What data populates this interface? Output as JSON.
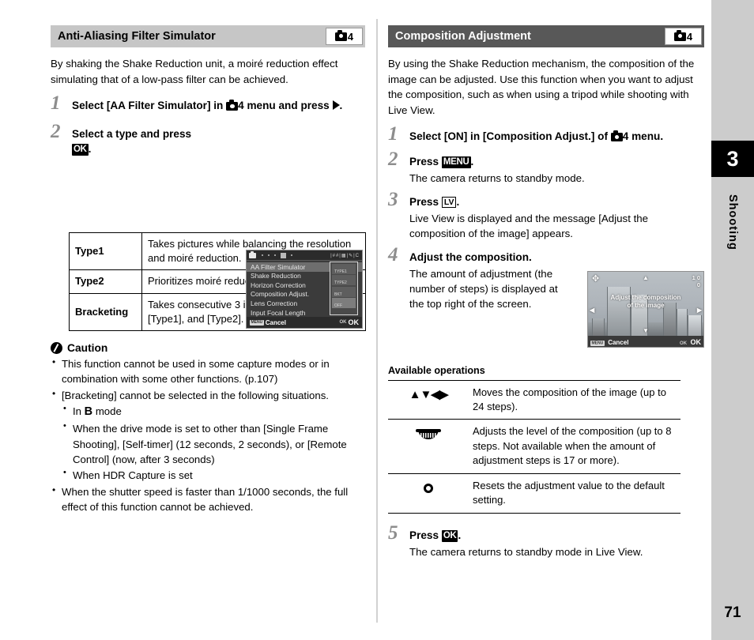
{
  "rail": {
    "chapter_number": "3",
    "chapter_label": "Shooting",
    "page_number": "71"
  },
  "left_column": {
    "header": {
      "title": "Anti-Aliasing Filter Simulator",
      "badge_icon": "camera-icon",
      "badge_number": "4"
    },
    "intro": "By shaking the Shake Reduction unit, a moiré reduction effect simulating that of a low-pass filter can be achieved.",
    "steps": [
      {
        "number": "1",
        "title_pre": "Select [AA Filter Simulator] in ",
        "title_badge_number": "4",
        "title_post": " menu and press "
      },
      {
        "number": "2",
        "title_pre": "Select a type and press ",
        "key": "OK",
        "title_post": "."
      }
    ],
    "menu_screenshot": {
      "name": "aa-filter-simulator-menu",
      "items": [
        "AA Filter Simulator",
        "Shake Reduction",
        "Horizon Correction",
        "Composition Adjust.",
        "Lens Correction",
        "Input Focal Length"
      ],
      "selected_item": "AA Filter Simulator",
      "options": [
        "TYPE1",
        "TYPE2",
        "BKT",
        "OFF"
      ],
      "selected_option": "OFF",
      "bottom_left_key": "MENU",
      "bottom_left_label": "Cancel",
      "bottom_right_key": "OK",
      "bottom_right_label": "OK",
      "top_right_tabs": "|##|▦|✎|C"
    },
    "type_table": {
      "rows": [
        {
          "key": "Type1",
          "value": "Takes pictures while balancing the resolution and moiré reduction."
        },
        {
          "key": "Type2",
          "value": "Prioritizes moiré reduction."
        },
        {
          "key": "Bracketing",
          "value": "Takes consecutive 3 images in order of [Off], [Type1], and [Type2]."
        }
      ]
    },
    "caution": {
      "title": "Caution",
      "icon": "caution-icon",
      "bullets": [
        {
          "text": "This function cannot be used in some capture modes or in combination with some other functions. (p.107)"
        },
        {
          "text": "[Bracketing] cannot be selected in the following situations.",
          "sub": [
            {
              "pre": "In ",
              "key": "B",
              "post": " mode"
            },
            {
              "pre": "When the drive mode is set to other than [Single Frame Shooting], [Self-timer] (12 seconds, 2 seconds), or [Remote Control] (now, after 3 seconds)"
            },
            {
              "pre": "When HDR Capture is set"
            }
          ]
        },
        {
          "text": "When the shutter speed is faster than 1/1000 seconds, the full effect of this function cannot be achieved."
        }
      ]
    }
  },
  "right_column": {
    "header": {
      "title": "Composition Adjustment",
      "badge_icon": "camera-icon",
      "badge_number": "4"
    },
    "intro": "By using the Shake Reduction mechanism, the composition of the image can be adjusted. Use this function when you want to adjust the composition, such as when using a tripod while shooting with Live View.",
    "steps": [
      {
        "number": "1",
        "title_pre": "Select [ON] in [Composition Adjust.] of ",
        "title_badge_number": "4",
        "title_post": " menu.",
        "desc": ""
      },
      {
        "number": "2",
        "title_pre": "Press ",
        "key": "MENU",
        "title_post": ".",
        "desc": "The camera returns to standby mode."
      },
      {
        "number": "3",
        "title_pre": "Press ",
        "key": "LV",
        "title_post": ".",
        "desc": "Live View is displayed and the message [Adjust the composition of the image] appears."
      },
      {
        "number": "4",
        "title_pre": "Adjust the composition.",
        "desc": "The amount of adjustment (the number of steps) is displayed at the top right of the screen."
      },
      {
        "number": "5",
        "title_pre": "Press ",
        "key": "OK",
        "title_post": ".",
        "desc": "The camera returns to standby mode in Live View."
      }
    ],
    "lv_screenshot": {
      "name": "live-view-composition-adjust",
      "message_line1": "Adjust the composition",
      "message_line2": "of the image",
      "steps_readout": "1 0",
      "readout_h": "0",
      "readout_v": "0",
      "bottom_left_key": "MENU",
      "bottom_left_label": "Cancel",
      "bottom_right_key": "OK",
      "bottom_right_label": "OK"
    },
    "operations": {
      "title": "Available operations",
      "rows": [
        {
          "icon": "arrow-pad-icon",
          "icon_text": "▲▼◀▶",
          "desc": "Moves the composition of the image (up to 24 steps)."
        },
        {
          "icon": "e-dial-icon",
          "icon_text": "",
          "desc": "Adjusts the level of the composition (up to 8 steps. Not available when the amount of adjustment steps is 17 or more)."
        },
        {
          "icon": "green-button-icon",
          "icon_text": "",
          "desc": "Resets the adjustment value to the default setting."
        }
      ]
    }
  }
}
